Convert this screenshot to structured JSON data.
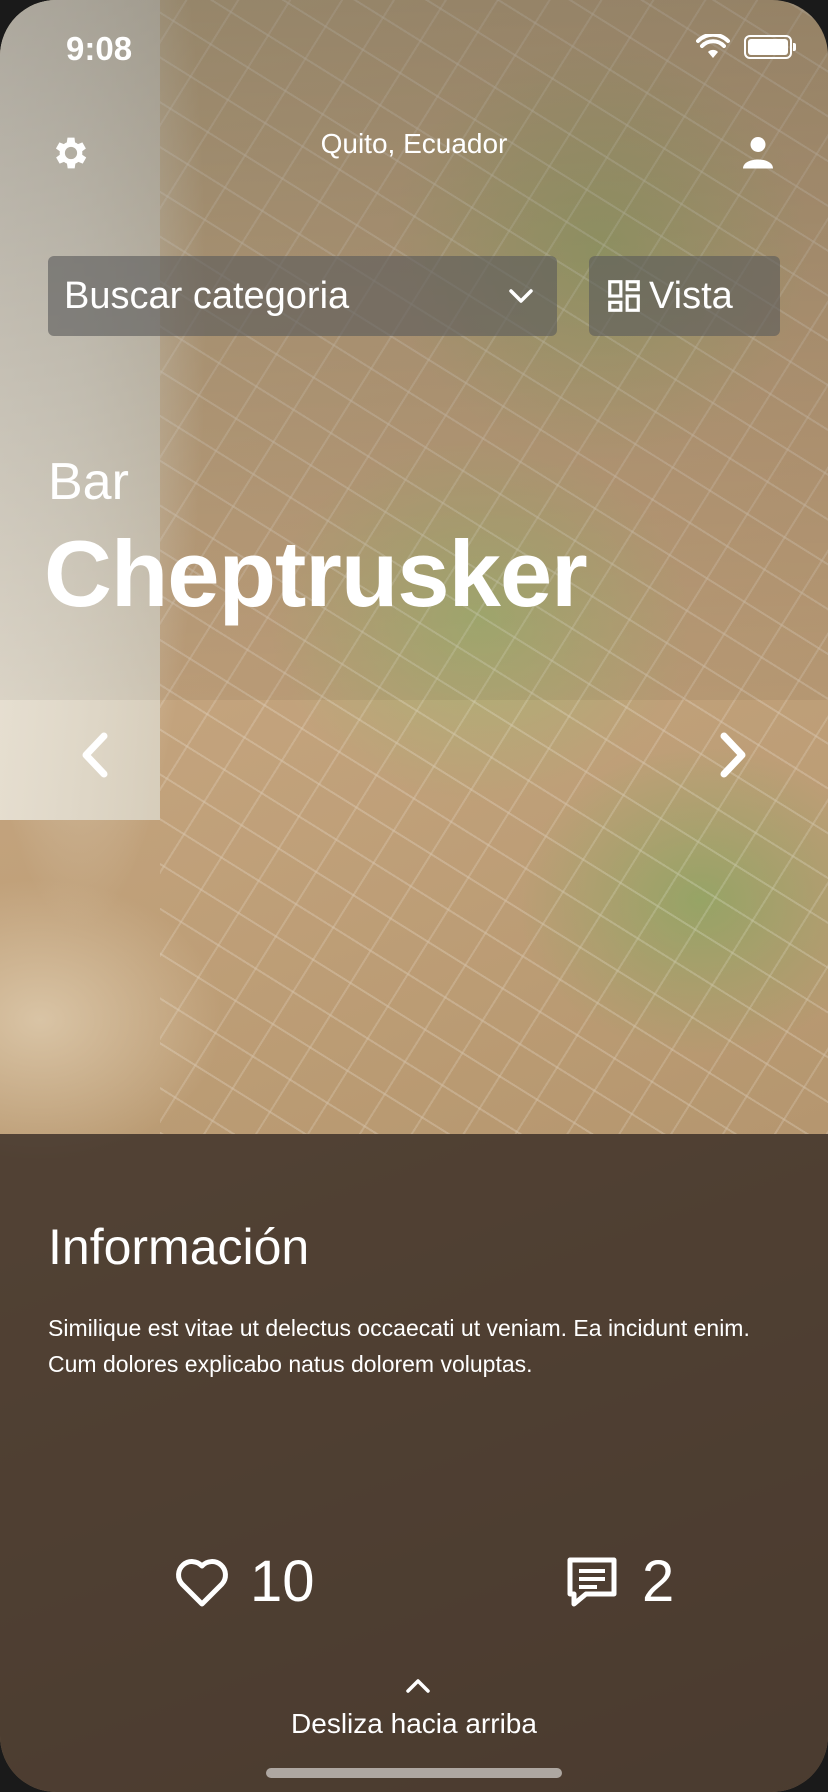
{
  "status_bar": {
    "time": "9:08",
    "battery_level": 1.0
  },
  "header": {
    "location": "Quito, Ecuador",
    "settings_icon": "gear-icon",
    "profile_icon": "user-icon"
  },
  "search": {
    "placeholder": "Buscar categoria",
    "icon": "chevron-down-icon"
  },
  "view_button": {
    "label": "Vista",
    "icon": "dashboard-grid-icon"
  },
  "place": {
    "category": "Bar",
    "name": "Cheptrusker"
  },
  "carousel": {
    "prev_icon": "chevron-left-icon",
    "next_icon": "chevron-right-icon"
  },
  "info": {
    "title": "Información",
    "body": "Similique est vitae ut delectus occaecati ut veniam. Ea incidunt enim. Cum dolores explicabo natus dolorem voluptas."
  },
  "stats": {
    "likes": "10",
    "comments": "2",
    "like_icon": "heart-icon",
    "comment_icon": "comment-icon"
  },
  "footer": {
    "swipe_label": "Desliza hacia arriba",
    "swipe_icon": "chevron-up-icon"
  }
}
